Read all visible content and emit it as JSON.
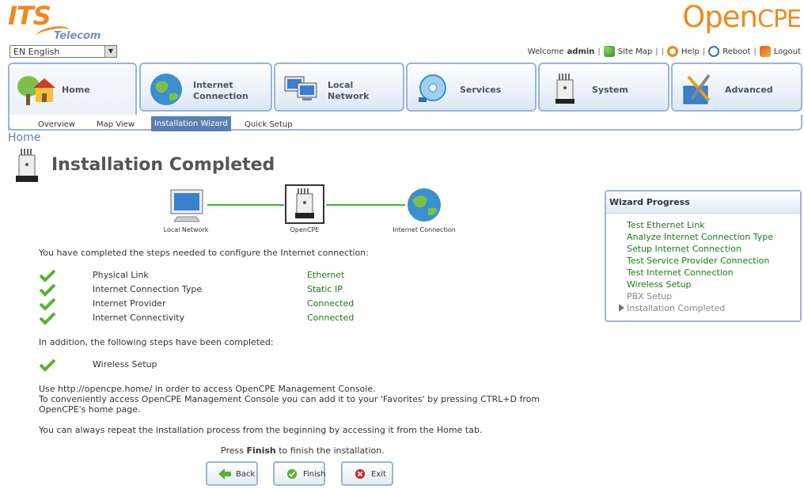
{
  "branding": {
    "its_main": "ITS",
    "its_sub": "Telecom",
    "opencpe_open": "Open",
    "opencpe_cpe": "CPE"
  },
  "language": {
    "selected": "EN English"
  },
  "top_links": {
    "welcome": "Welcome",
    "user": "admin",
    "sitemap": "Site Map",
    "help": "Help",
    "reboot": "Reboot",
    "logout": "Logout"
  },
  "tabs": [
    {
      "line1": "Home",
      "line2": ""
    },
    {
      "line1": "Internet",
      "line2": "Connection"
    },
    {
      "line1": "Local",
      "line2": "Network"
    },
    {
      "line1": "Services",
      "line2": ""
    },
    {
      "line1": "System",
      "line2": ""
    },
    {
      "line1": "Advanced",
      "line2": ""
    }
  ],
  "subnav": [
    "Overview",
    "Map View",
    "Installation Wizard",
    "Quick Setup"
  ],
  "breadcrumb": "Home",
  "page_title": "Installation Completed",
  "diagram": {
    "left": "Local Network",
    "center": "OpenCPE",
    "right": "Internet Connection"
  },
  "intro": "You have completed the steps needed to configure the Internet connection:",
  "status_rows": [
    {
      "label": "Physical Link",
      "value": "Ethernet"
    },
    {
      "label": "Internet Connection Type",
      "value": "Static IP"
    },
    {
      "label": "Internet Provider",
      "value": "Connected"
    },
    {
      "label": "Internet Connectivity",
      "value": "Connected"
    }
  ],
  "addition_text": "In addition, the following steps have been completed:",
  "additional_steps": [
    "Wireless Setup"
  ],
  "info_lines": [
    "Use http://opencpe.home/ in order to access OpenCPE Management Console.",
    "To conveniently access OpenCPE Management Console you can add it to your 'Favorites' by pressing CTRL+D from",
    "OpenCPE's home page."
  ],
  "repeat_text": "You can always repeat the installation process from the beginning by accessing it from the Home tab.",
  "finish_prompt": {
    "pre": "Press ",
    "bold": "Finish",
    "post": " to finish the installation."
  },
  "buttons": {
    "back": "Back",
    "finish": "Finish",
    "exit": "Exit"
  },
  "wizard": {
    "title": "Wizard Progress",
    "steps": [
      {
        "label": "Test Ethernet Link",
        "state": "done"
      },
      {
        "label": "Analyze Internet Connection Type",
        "state": "done"
      },
      {
        "label": "Setup Internet Connection",
        "state": "done"
      },
      {
        "label": "Test Service Provider Connection",
        "state": "done"
      },
      {
        "label": "Test Internet Connection",
        "state": "done"
      },
      {
        "label": "Wireless Setup",
        "state": "done"
      },
      {
        "label": "PBX Setup",
        "state": "pending"
      },
      {
        "label": "Installation Completed",
        "state": "current"
      }
    ]
  },
  "colors": {
    "accent_orange": "#f08a1c",
    "tab_border": "#9bb4d4",
    "done_green": "#1b7a1b",
    "link_blue": "#5a7fb0"
  }
}
